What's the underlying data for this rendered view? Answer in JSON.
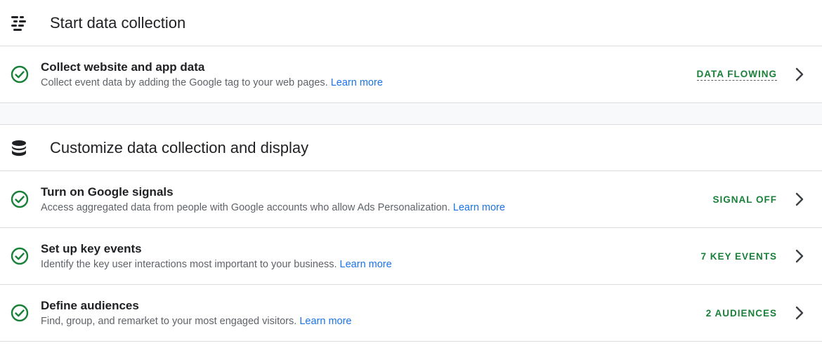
{
  "sections": [
    {
      "icon": "data-stream-icon",
      "title": "Start data collection",
      "items": [
        {
          "title": "Collect website and app data",
          "description": "Collect event data by adding the Google tag to your web pages.",
          "link": "Learn more",
          "status": "DATA FLOWING"
        }
      ]
    },
    {
      "icon": "database-icon",
      "title": "Customize data collection and display",
      "items": [
        {
          "title": "Turn on Google signals",
          "description": "Access aggregated data from people with Google accounts who allow Ads Personalization.",
          "link": "Learn more",
          "status": "SIGNAL OFF"
        },
        {
          "title": "Set up key events",
          "description": "Identify the key user interactions most important to your business.",
          "link": "Learn more",
          "status": "7 KEY EVENTS"
        },
        {
          "title": "Define audiences",
          "description": "Find, group, and remarket to your most engaged visitors.",
          "link": "Learn more",
          "status": "2 AUDIENCES"
        }
      ]
    }
  ],
  "colors": {
    "accent_green": "#188038",
    "link_blue": "#1a73e8"
  }
}
